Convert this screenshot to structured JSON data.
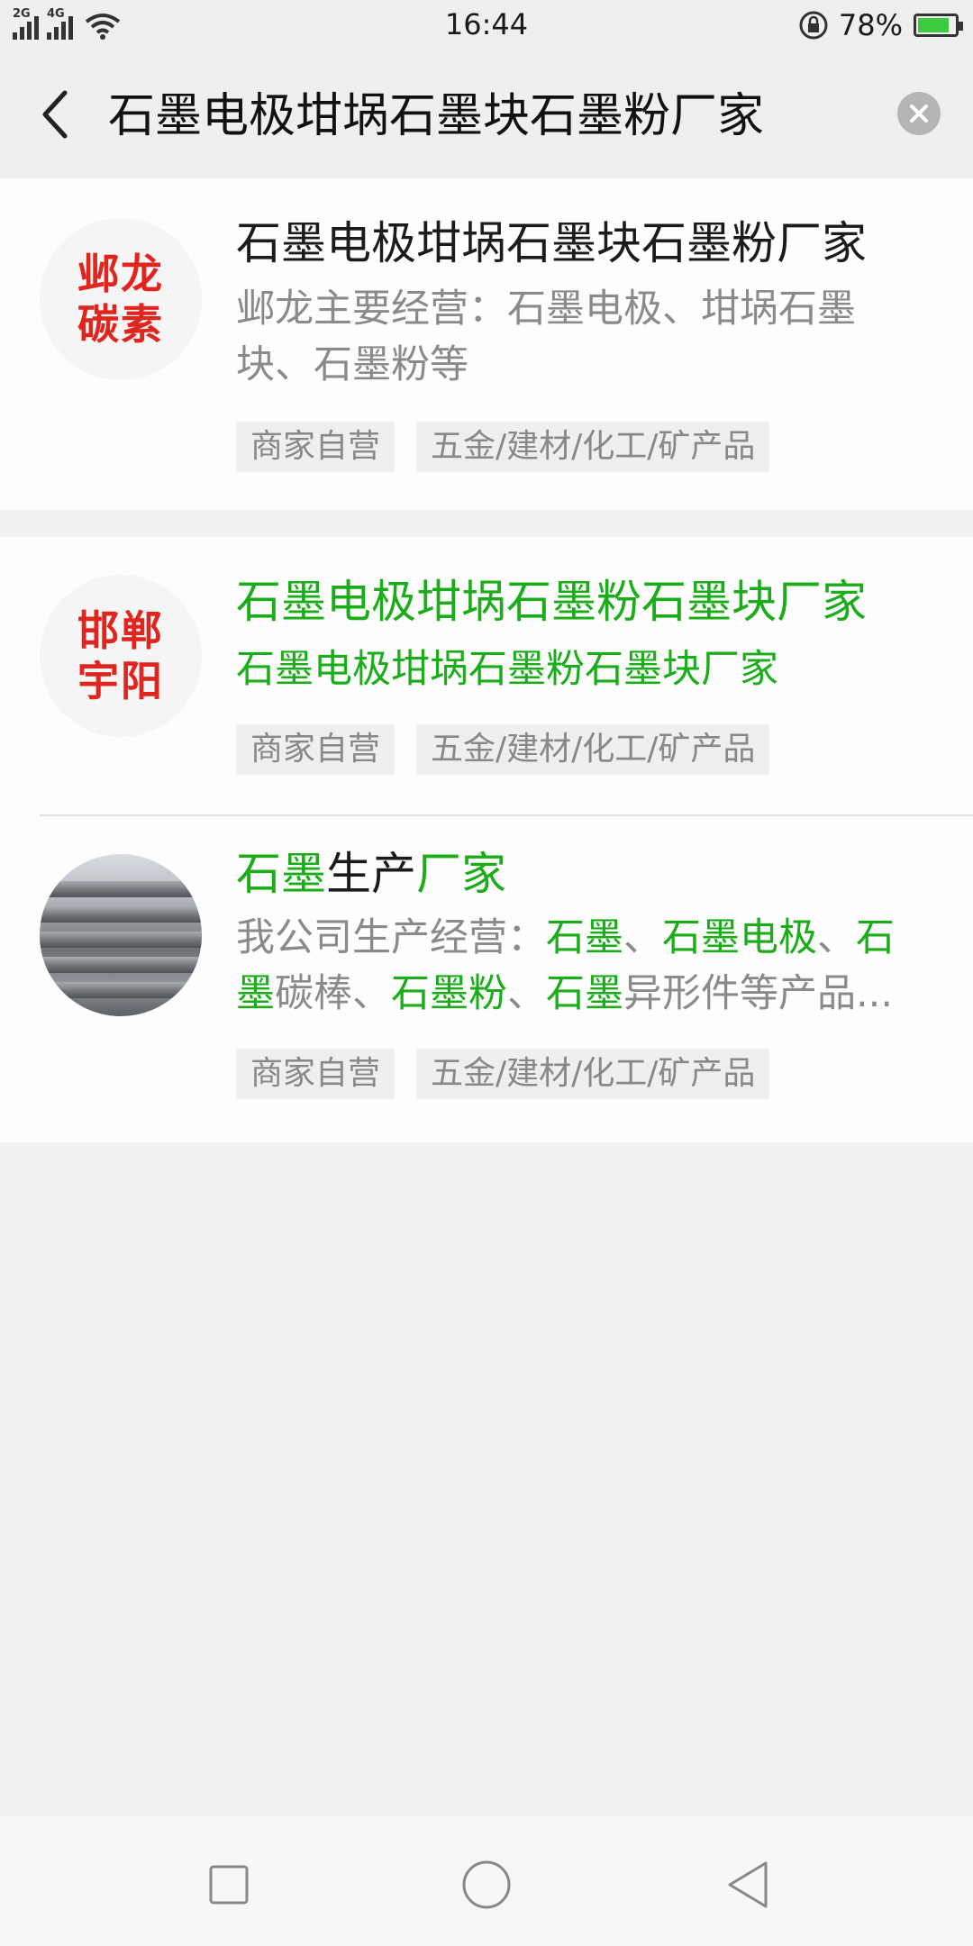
{
  "status_bar": {
    "signal1_label": "2G",
    "signal2_label": "4G",
    "time": "16:44",
    "battery_percent": "78%",
    "battery_level": 0.78
  },
  "search": {
    "query": "石墨电极坩埚石墨块石墨粉厂家"
  },
  "results": [
    {
      "logo_line1": "邺龙",
      "logo_line2": "碳素",
      "title": "石墨电极坩埚石墨块石墨粉厂家",
      "desc_line1": "邺龙主要经营：石墨电极、坩埚石墨",
      "desc_line2": "块、石墨粉等",
      "tag1": "商家自营",
      "tag2": "五金/建材/化工/矿产品"
    },
    {
      "logo_line1": "邯郸",
      "logo_line2": "宇阳",
      "title": "石墨电极坩埚石墨粉石墨块厂家",
      "desc": "石墨电极坩埚石墨粉石墨块厂家",
      "tag1": "商家自营",
      "tag2": "五金/建材/化工/矿产品"
    },
    {
      "title_a": "石墨",
      "title_b": "生产",
      "title_c": "厂家",
      "desc1": "我公司生产经营：",
      "desc2": "石墨",
      "desc3": "、",
      "desc4": "石墨电极",
      "desc5": "、",
      "desc6": "石",
      "desc7": "墨",
      "desc8": "碳棒、",
      "desc9": "石墨粉",
      "desc10": "、",
      "desc11": "石墨",
      "desc12": "异形件等产品...",
      "tag1": "商家自营",
      "tag2": "五金/建材/化工/矿产品"
    }
  ],
  "icons": {
    "back": "chevron-left-icon",
    "clear": "close-icon",
    "nav_recent": "square-icon",
    "nav_home": "circle-icon",
    "nav_back": "triangle-back-icon"
  },
  "colors": {
    "highlight_green": "#1aad19",
    "logo_red": "#e0241e"
  }
}
